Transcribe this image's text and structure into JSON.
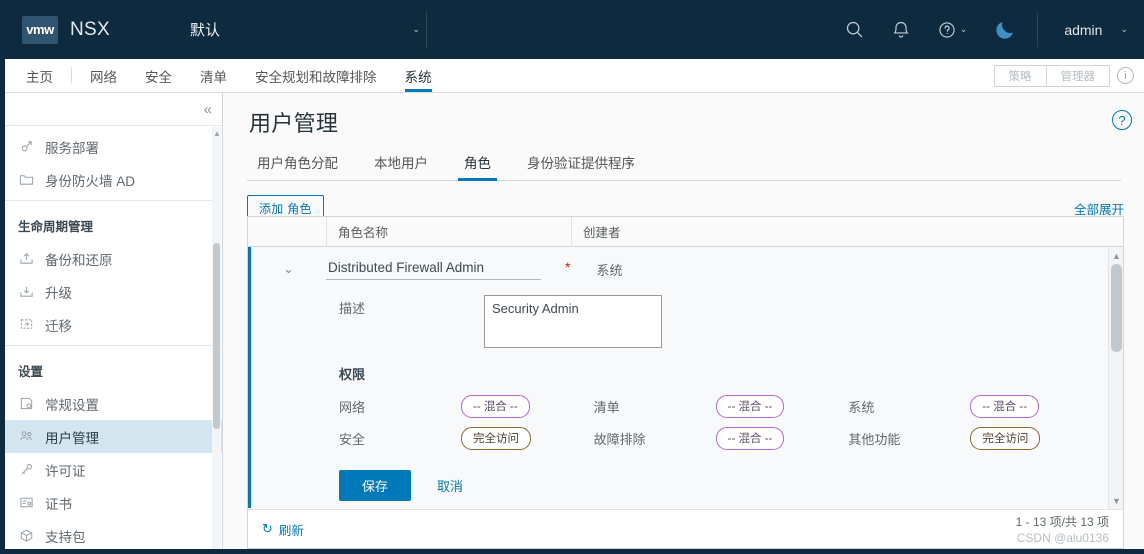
{
  "header": {
    "logo_text": "vmw",
    "brand": "NSX",
    "tenant": "默认",
    "tenant_chevron": "⌄",
    "search_icon": "search-icon",
    "bell_icon": "bell-icon",
    "help_icon": "help-icon",
    "help_chevron": "⌄",
    "theme_icon": "moon-icon",
    "username": "admin",
    "user_chevron": "⌄"
  },
  "nav": {
    "home": "主页",
    "items": [
      {
        "label": "网络",
        "active": false
      },
      {
        "label": "安全",
        "active": false
      },
      {
        "label": "清单",
        "active": false
      },
      {
        "label": "安全规划和故障排除",
        "active": false
      },
      {
        "label": "系统",
        "active": true
      }
    ],
    "policy_btn": "策略",
    "manager_btn": "管理器",
    "info_icon": "ⓘ"
  },
  "sidebar": {
    "collapse_icon": "«",
    "groups": [
      {
        "header": "",
        "items": [
          {
            "label": "服务部署",
            "icon": "deploy-icon",
            "active": false
          },
          {
            "label": "身份防火墙 AD",
            "icon": "folder-icon",
            "active": false
          }
        ]
      },
      {
        "header": "生命周期管理",
        "items": [
          {
            "label": "备份和还原",
            "icon": "backup-icon",
            "active": false
          },
          {
            "label": "升级",
            "icon": "upgrade-icon",
            "active": false
          },
          {
            "label": "迁移",
            "icon": "migrate-icon",
            "active": false
          }
        ]
      },
      {
        "header": "设置",
        "items": [
          {
            "label": "常规设置",
            "icon": "settings-icon",
            "active": false
          },
          {
            "label": "用户管理",
            "icon": "users-icon",
            "active": true
          },
          {
            "label": "许可证",
            "icon": "license-icon",
            "active": false
          },
          {
            "label": "证书",
            "icon": "certificate-icon",
            "active": false
          },
          {
            "label": "支持包",
            "icon": "bundle-icon",
            "active": false
          }
        ]
      }
    ]
  },
  "page": {
    "title": "用户管理",
    "help_icon": "?",
    "tabs": [
      {
        "label": "用户角色分配",
        "active": false
      },
      {
        "label": "本地用户",
        "active": false
      },
      {
        "label": "角色",
        "active": true
      },
      {
        "label": "身份验证提供程序",
        "active": false
      }
    ],
    "add_button": "添加 角色",
    "expand_all": "全部展开"
  },
  "table": {
    "columns": [
      "",
      "角色名称",
      "创建者"
    ],
    "row": {
      "expand_icon": "⌄",
      "role_name": "Distributed Firewall Admin",
      "role_name_placeholder": "角色名称",
      "required_marker": "*",
      "creator": "系统",
      "description_label": "描述",
      "description_value": "Security Admin",
      "description_placeholder": "描述",
      "permissions_label": "权限",
      "permissions": [
        {
          "name": "网络",
          "value": "-- 混合 --",
          "style": "mixed"
        },
        {
          "name": "清单",
          "value": "-- 混合 --",
          "style": "mixed"
        },
        {
          "name": "系统",
          "value": "-- 混合 --",
          "style": "mixed"
        },
        {
          "name": "安全",
          "value": "完全访问",
          "style": "full"
        },
        {
          "name": "故障排除",
          "value": "-- 混合 --",
          "style": "mixed"
        },
        {
          "name": "其他功能",
          "value": "完全访问",
          "style": "full"
        }
      ],
      "save_button": "保存",
      "cancel_button": "取消"
    }
  },
  "footer": {
    "refresh_icon": "↻",
    "refresh_label": "刷新",
    "count": "1 - 13 项/共 13 项",
    "watermark": "CSDN @alu0136"
  },
  "colors": {
    "header_bg": "#0d2a3f",
    "accent_blue": "#0079b8",
    "active_sidebar_bg": "#d3e5ef",
    "badge_mixed_border": "#b367d3",
    "badge_full_border": "#8a6a28",
    "required_red": "#c92100"
  }
}
